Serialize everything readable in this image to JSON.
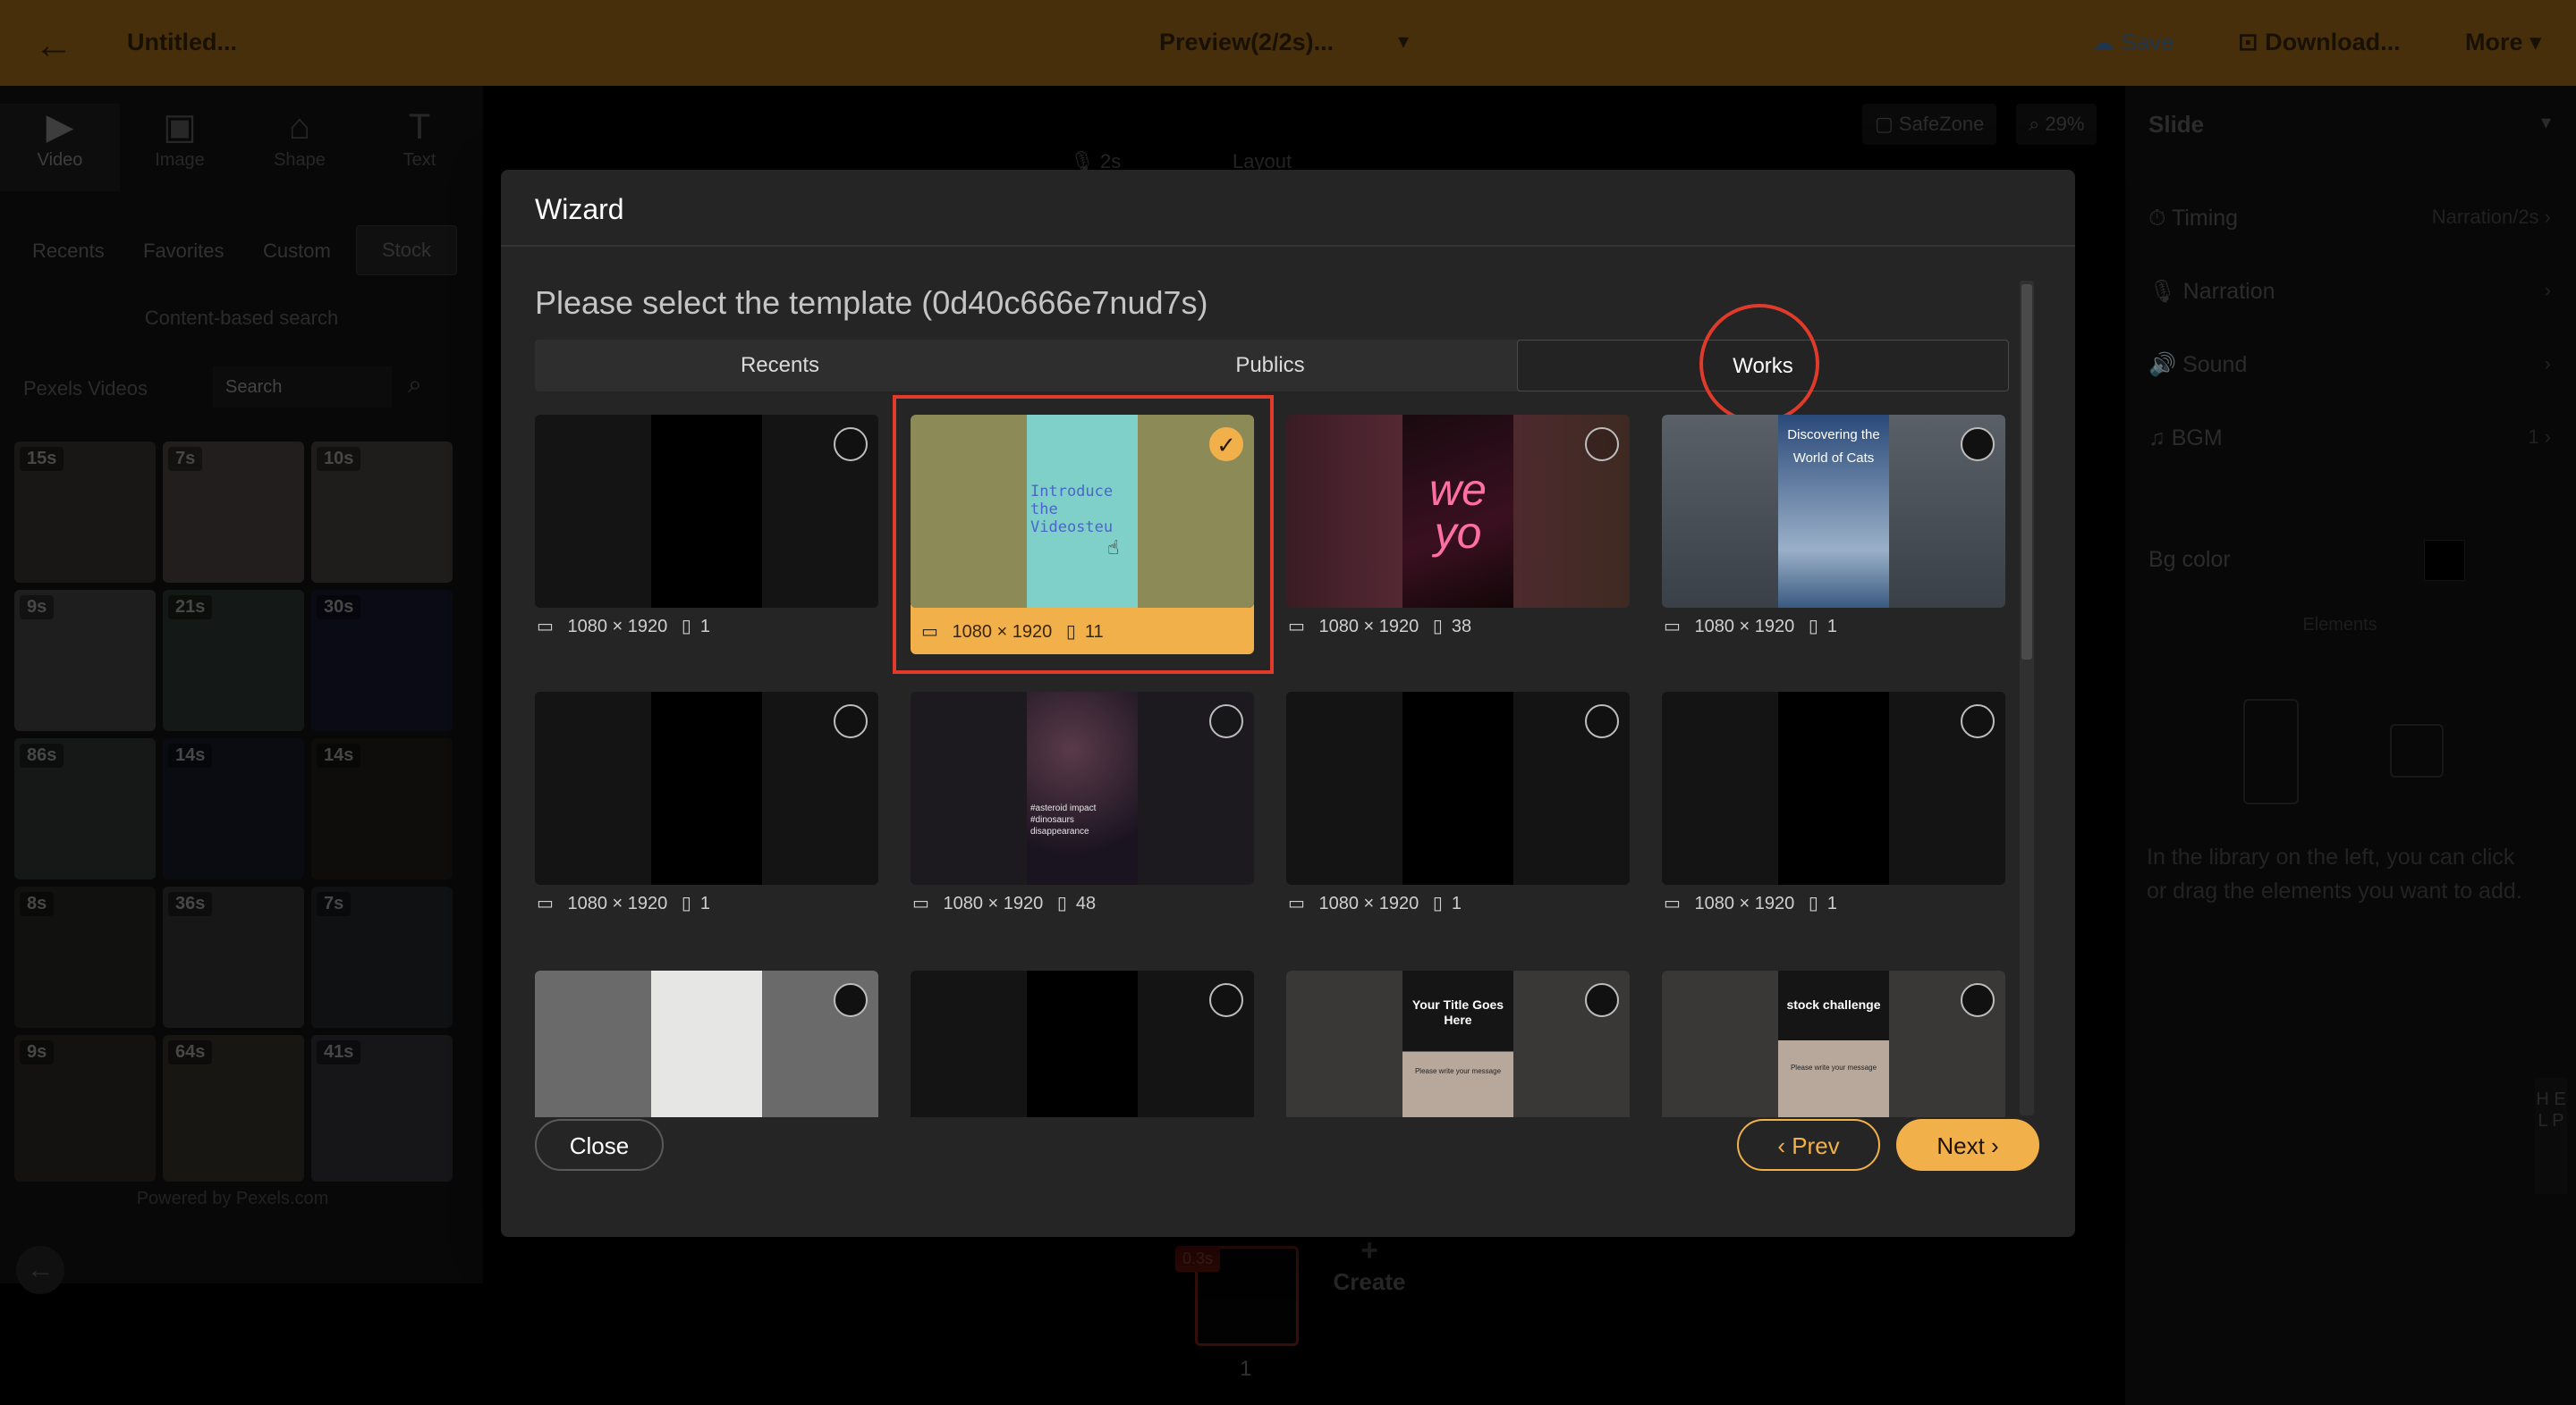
{
  "topbar": {
    "back_icon": "←",
    "doc_title": "Untitled...",
    "preview": "Preview(2/2s)...",
    "caret": "▾",
    "save": "☁ Save",
    "download": "⊡ Download...",
    "more": "More ▾"
  },
  "left_panel": {
    "tools": [
      {
        "icon": "▶",
        "label": "Video"
      },
      {
        "icon": "▣",
        "label": "Image"
      },
      {
        "icon": "⌂",
        "label": "Shape"
      },
      {
        "icon": "T",
        "label": "Text"
      }
    ],
    "subtabs": [
      "Recents",
      "Favorites",
      "Custom",
      "Stock"
    ],
    "content_search": "Content-based search",
    "pexels_label": "Pexels Videos",
    "search_placeholder": "Search",
    "search_icon": "⌕",
    "durations": [
      "15s",
      "7s",
      "10s",
      "9s",
      "21s",
      "30s",
      "86s",
      "14s",
      "14s",
      "8s",
      "36s",
      "7s",
      "9s",
      "64s",
      "41s"
    ],
    "powered": "Powered by Pexels.com"
  },
  "canvas_tools": {
    "narration": "🎙 2s",
    "layout": "Layout",
    "safezone": "▢ SafeZone",
    "zoom": "⌕ 29%"
  },
  "right_panel": {
    "title": "Slide",
    "title_caret": "▾",
    "rows": [
      {
        "label": "⏱ Timing",
        "value": "Narration/2s ›"
      },
      {
        "label": "🎙 Narration",
        "value": "›"
      },
      {
        "label": "🔊 Sound",
        "value": "›"
      },
      {
        "label": "♫ BGM",
        "value": "1 ›"
      }
    ],
    "bg_color": "Bg color",
    "elements": "Elements",
    "hint": "In the library on the left, you can click or drag the elements you want to add."
  },
  "timeline": {
    "duration": "0.3s",
    "slide_number": "1",
    "create": "Create",
    "plus": "+"
  },
  "help": "H E L P",
  "wizard": {
    "title": "Wizard",
    "prompt": "Please select the template (0d40c666e7nud7s)",
    "tabs": [
      "Recents",
      "Publics",
      "Works"
    ],
    "active_tab": "Works",
    "templates": [
      {
        "size": "1080 × 1920",
        "pages": "1"
      },
      {
        "size": "1080 × 1920",
        "pages": "11",
        "text": "Introduce the Videosteu"
      },
      {
        "size": "1080 × 1920",
        "pages": "38",
        "text": "we yo"
      },
      {
        "size": "1080 × 1920",
        "pages": "1",
        "text": "Discovering the World of Cats"
      },
      {
        "size": "1080 × 1920",
        "pages": "1"
      },
      {
        "size": "1080 × 1920",
        "pages": "48",
        "text": "#asteroid impact #dinosaurs disappearance"
      },
      {
        "size": "1080 × 1920",
        "pages": "1"
      },
      {
        "size": "1080 × 1920",
        "pages": "1"
      },
      {},
      {},
      {
        "text": "Your Title Goes Here",
        "subtext": "Please write your message"
      },
      {
        "text": "stock challenge",
        "subtext": "Please write your message"
      }
    ],
    "size_icon": "▭",
    "pages_icon": "▯",
    "check_icon": "✓",
    "close": "Close",
    "prev": "‹ Prev",
    "next": "Next ›"
  },
  "colors": {
    "accent": "#f2b04a",
    "annotation": "#e03b2a",
    "modal_bg": "#252525"
  }
}
